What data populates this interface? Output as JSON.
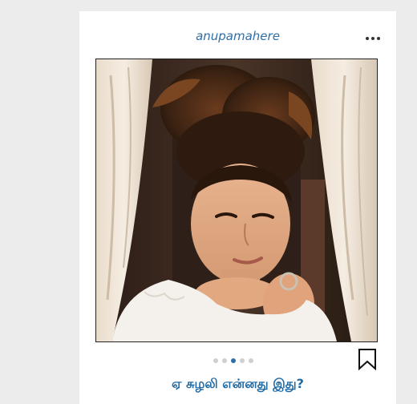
{
  "post": {
    "username": "anupamahere",
    "caption": "ஏ சுழலி என்னது இது?",
    "carousel": {
      "total": 5,
      "active_index": 2
    },
    "photo_icon": "portrait-photo",
    "more_icon": "more-horizontal-icon",
    "bookmark_icon": "bookmark-icon"
  },
  "colors": {
    "accent": "#2f6fa8",
    "caption": "#1f6aa5",
    "background": "#ececec",
    "card": "#ffffff"
  }
}
